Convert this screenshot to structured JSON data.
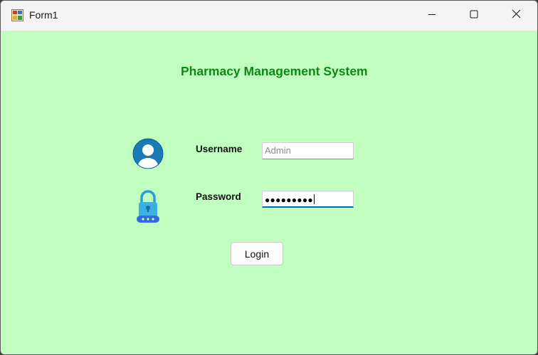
{
  "window": {
    "title": "Form1"
  },
  "form": {
    "heading": "Pharmacy Management System",
    "username": {
      "label": "Username",
      "value": "Admin"
    },
    "password": {
      "label": "Password",
      "masked_value": "●●●●●●●●●"
    },
    "login_label": "Login"
  },
  "colors": {
    "background": "#c0ffc0",
    "heading": "#0b8a12",
    "focus_accent": "#0067c0"
  },
  "icons": {
    "app": "winforms-app-icon",
    "user": "user-avatar-icon",
    "password": "padlock-icon",
    "minimize": "minimize-icon",
    "maximize": "maximize-icon",
    "close": "close-icon"
  }
}
